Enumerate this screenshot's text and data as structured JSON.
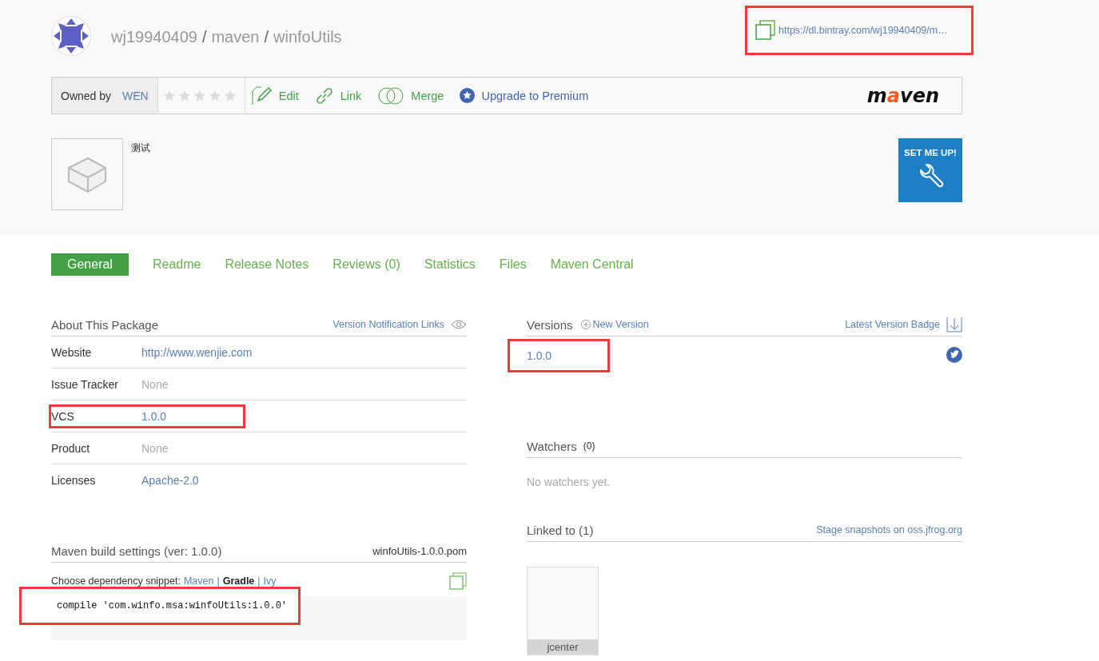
{
  "breadcrumb": {
    "owner": "wj19940409",
    "repo": "maven",
    "package": "winfoUtils",
    "separators": [
      "/",
      "/"
    ]
  },
  "download_url": {
    "text": "https://dl.bintray.com/wj19940409/m…",
    "highlighted": true
  },
  "toolbar": {
    "owned_by_label": "Owned by",
    "owner": "WEN",
    "stars": 0,
    "actions": [
      {
        "kind": "edit",
        "label": "Edit"
      },
      {
        "kind": "link",
        "label": "Link"
      },
      {
        "kind": "merge",
        "label": "Merge"
      },
      {
        "kind": "premium",
        "label": "Upgrade to Premium"
      }
    ],
    "logo": {
      "parts": [
        "m",
        "a",
        "ven"
      ]
    }
  },
  "package": {
    "description": "测试",
    "setup_button": "SET ME UP!"
  },
  "tabs": [
    {
      "label": "General",
      "selected": true
    },
    {
      "label": "Readme",
      "selected": false
    },
    {
      "label": "Release Notes",
      "selected": false
    },
    {
      "label": "Reviews (0)",
      "selected": false
    },
    {
      "label": "Statistics",
      "selected": false
    },
    {
      "label": "Files",
      "selected": false
    },
    {
      "label": "Maven Central",
      "selected": false
    }
  ],
  "about": {
    "title": "About This Package",
    "notification_link": "Version Notification Links",
    "rows": [
      {
        "label": "Website",
        "value": "http://www.wenjie.com",
        "kind": "link",
        "highlighted": false
      },
      {
        "label": "Issue Tracker",
        "value": "None",
        "kind": "empty",
        "highlighted": false
      },
      {
        "label": "VCS",
        "value": "1.0.0",
        "kind": "link",
        "highlighted": true
      },
      {
        "label": "Product",
        "value": "None",
        "kind": "empty",
        "highlighted": false
      },
      {
        "label": "Licenses",
        "value": "Apache-2.0",
        "kind": "link",
        "highlighted": false
      }
    ]
  },
  "build": {
    "title": "Maven build settings (ver: 1.0.0)",
    "pom": "winfoUtils-1.0.0.pom",
    "snippet_label": "Choose dependency snippet:",
    "separators": [
      "|",
      "|"
    ],
    "snippets": [
      {
        "label": "Maven",
        "selected": false
      },
      {
        "label": "Gradle",
        "selected": true
      },
      {
        "label": "Ivy",
        "selected": false
      }
    ],
    "code": "compile 'com.winfo.msa:winfoUtils:1.0.0'",
    "code_highlighted": true
  },
  "versions": {
    "title": "Versions",
    "new_version": "New Version",
    "badge_link": "Latest Version Badge",
    "items": [
      {
        "label": "1.0.0",
        "highlighted": true
      }
    ]
  },
  "watchers": {
    "title": "Watchers",
    "count": "(0)",
    "empty_text": "No watchers yet."
  },
  "linked": {
    "title": "Linked to (1)",
    "stage_link": "Stage snapshots on oss.jfrog.org",
    "repos": [
      {
        "name": "jcenter"
      }
    ]
  }
}
